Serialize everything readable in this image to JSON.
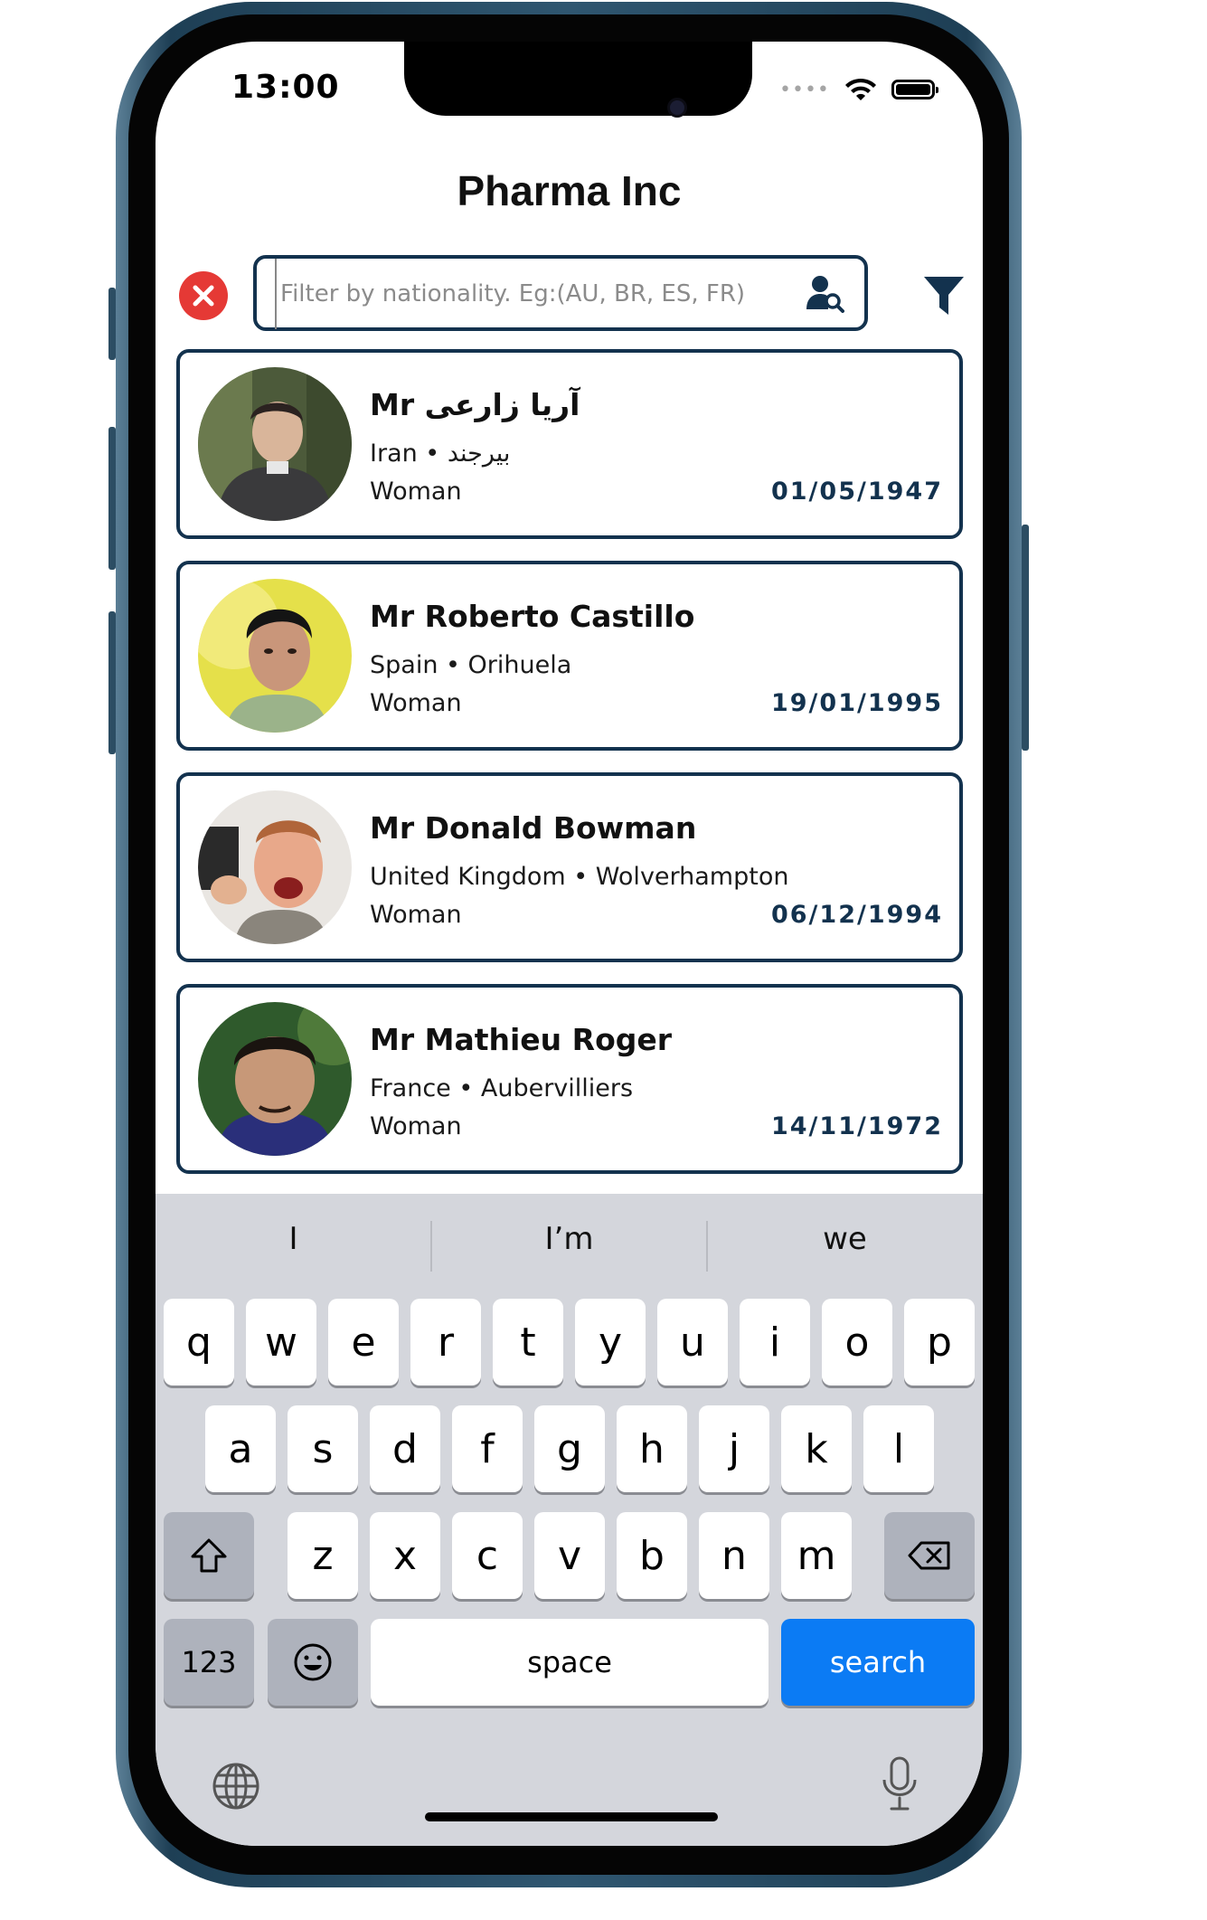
{
  "status_bar": {
    "time": "13:00",
    "signal": "••••"
  },
  "app": {
    "title": "Pharma Inc"
  },
  "search": {
    "placeholder": "Filter by nationality. Eg:(AU, BR, ES, FR)",
    "value": ""
  },
  "colors": {
    "primary": "#13324e",
    "danger": "#e53935",
    "keyboard_accent": "#0b7bf4"
  },
  "users": [
    {
      "name": "Mr آریا زارعی",
      "location": "Iran • بیرجند",
      "gender": "Woman",
      "dob": "01/05/1947"
    },
    {
      "name": "Mr Roberto Castillo",
      "location": "Spain • Orihuela",
      "gender": "Woman",
      "dob": "19/01/1995"
    },
    {
      "name": "Mr Donald Bowman",
      "location": "United Kingdom • Wolverhampton",
      "gender": "Woman",
      "dob": "06/12/1994"
    },
    {
      "name": "Mr Mathieu Roger",
      "location": "France • Aubervilliers",
      "gender": "Woman",
      "dob": "14/11/1972"
    }
  ],
  "keyboard": {
    "suggestions": [
      "I",
      "I’m",
      "we"
    ],
    "row1": [
      "q",
      "w",
      "e",
      "r",
      "t",
      "y",
      "u",
      "i",
      "o",
      "p"
    ],
    "row2": [
      "a",
      "s",
      "d",
      "f",
      "g",
      "h",
      "j",
      "k",
      "l"
    ],
    "row3": [
      "z",
      "x",
      "c",
      "v",
      "b",
      "n",
      "m"
    ],
    "numbers_label": "123",
    "space_label": "space",
    "search_label": "search"
  },
  "icons": {
    "clear": "close-circle-icon",
    "person_search": "person-search-icon",
    "filter": "filter-icon",
    "shift": "shift-arrow-icon",
    "backspace": "backspace-icon",
    "emoji": "emoji-icon",
    "globe": "globe-icon",
    "mic": "microphone-icon"
  }
}
